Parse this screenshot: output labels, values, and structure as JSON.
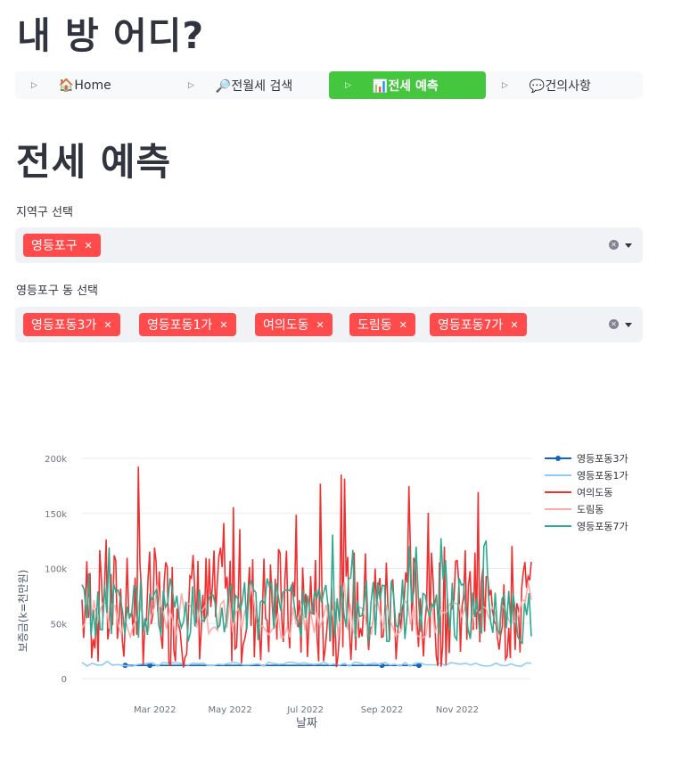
{
  "app": {
    "title": "내 방 어디?"
  },
  "nav": {
    "items": [
      {
        "label": "🏠Home"
      },
      {
        "label": "🔎전월세 검색"
      },
      {
        "label": "📊전세 예측"
      },
      {
        "label": "💬건의사항"
      }
    ],
    "active_index": 2,
    "active_color": "#45c63f"
  },
  "page": {
    "title": "전세 예측"
  },
  "district": {
    "label": "지역구 선택",
    "selected": [
      "영등포구"
    ]
  },
  "dong": {
    "label": "영등포구 동 선택",
    "selected": [
      "영등포동3가",
      "영등포동1가",
      "여의도동",
      "도림동",
      "영등포동7가"
    ]
  },
  "tag_color": "#ff4b4b",
  "chart_data": {
    "type": "line",
    "xlabel": "날짜",
    "ylabel": "보증금(k=천만원)",
    "ylim": [
      0,
      200
    ],
    "yticks": [
      "0",
      "50k",
      "100k",
      "150k",
      "200k"
    ],
    "xticks": [
      "Mar 2022",
      "May 2022",
      "Jul 2022",
      "Sep 2022",
      "Nov 2022"
    ],
    "xrange": [
      "2022-01-01",
      "2022-12-31"
    ],
    "legend_position": "right",
    "series": [
      {
        "name": "영등포동3가",
        "color": "#1565c0",
        "markers": true,
        "points": [
          [
            "2022-02-05",
            12
          ],
          [
            "2022-02-25",
            12
          ],
          [
            "2022-09-01",
            12
          ],
          [
            "2022-10-01",
            12
          ]
        ]
      },
      {
        "name": "영등포동1가",
        "color": "#90caf9",
        "baseline": 13,
        "amp": 2,
        "seed": 11,
        "count": 90
      },
      {
        "name": "여의도동",
        "color": "#ef3030",
        "baseline": 65,
        "amp": 55,
        "seed": 7,
        "count": 280
      },
      {
        "name": "도림동",
        "color": "#ffaaaa",
        "baseline": 55,
        "amp": 18,
        "seed": 3,
        "count": 150
      },
      {
        "name": "영등포동7가",
        "color": "#2eaa8f",
        "baseline": 62,
        "amp": 30,
        "seed": 5,
        "count": 200
      }
    ]
  }
}
